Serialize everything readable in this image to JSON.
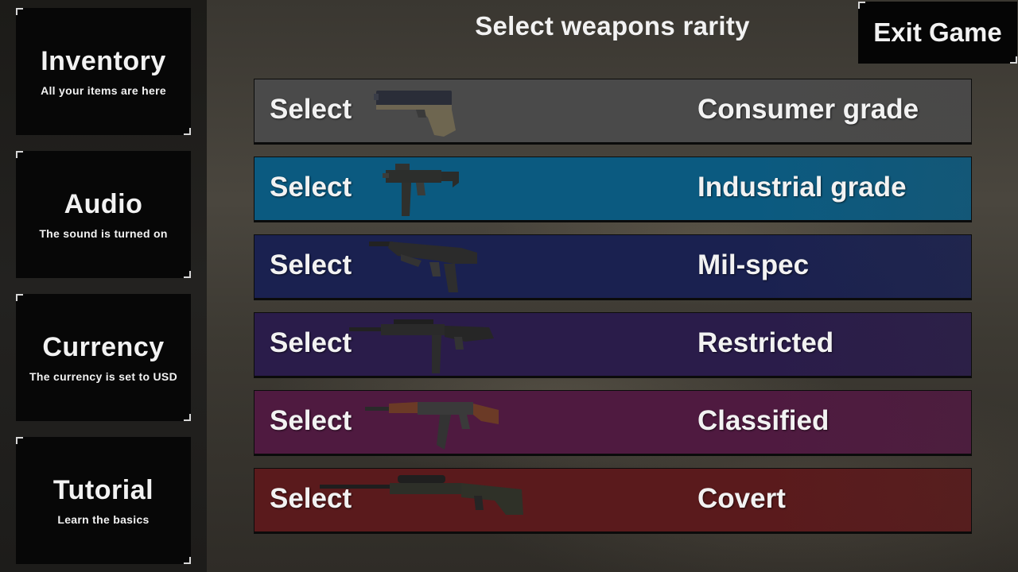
{
  "sidebar": {
    "items": [
      {
        "title": "Inventory",
        "subtitle": "All your items are here"
      },
      {
        "title": "Audio",
        "subtitle": "The sound is turned on"
      },
      {
        "title": "Currency",
        "subtitle": "The currency is set to USD"
      },
      {
        "title": "Tutorial",
        "subtitle": "Learn the basics"
      }
    ]
  },
  "header": {
    "title": "Select weapons rarity",
    "exit_label": "Exit Game"
  },
  "rarities": [
    {
      "select_label": "Select",
      "name": "Consumer grade",
      "color": "#4a4a4a",
      "weapon_icon": "pistol-icon"
    },
    {
      "select_label": "Select",
      "name": "Industrial grade",
      "color": "#0b5a80",
      "weapon_icon": "smg-icon"
    },
    {
      "select_label": "Select",
      "name": "Mil-spec",
      "color": "#1a2150",
      "weapon_icon": "shotgun-icon"
    },
    {
      "select_label": "Select",
      "name": "Restricted",
      "color": "#2a1c4a",
      "weapon_icon": "rifle-icon"
    },
    {
      "select_label": "Select",
      "name": "Classified",
      "color": "#4f1a40",
      "weapon_icon": "assault-rifle-icon"
    },
    {
      "select_label": "Select",
      "name": "Covert",
      "color": "#5a1a1c",
      "weapon_icon": "sniper-rifle-icon"
    }
  ]
}
